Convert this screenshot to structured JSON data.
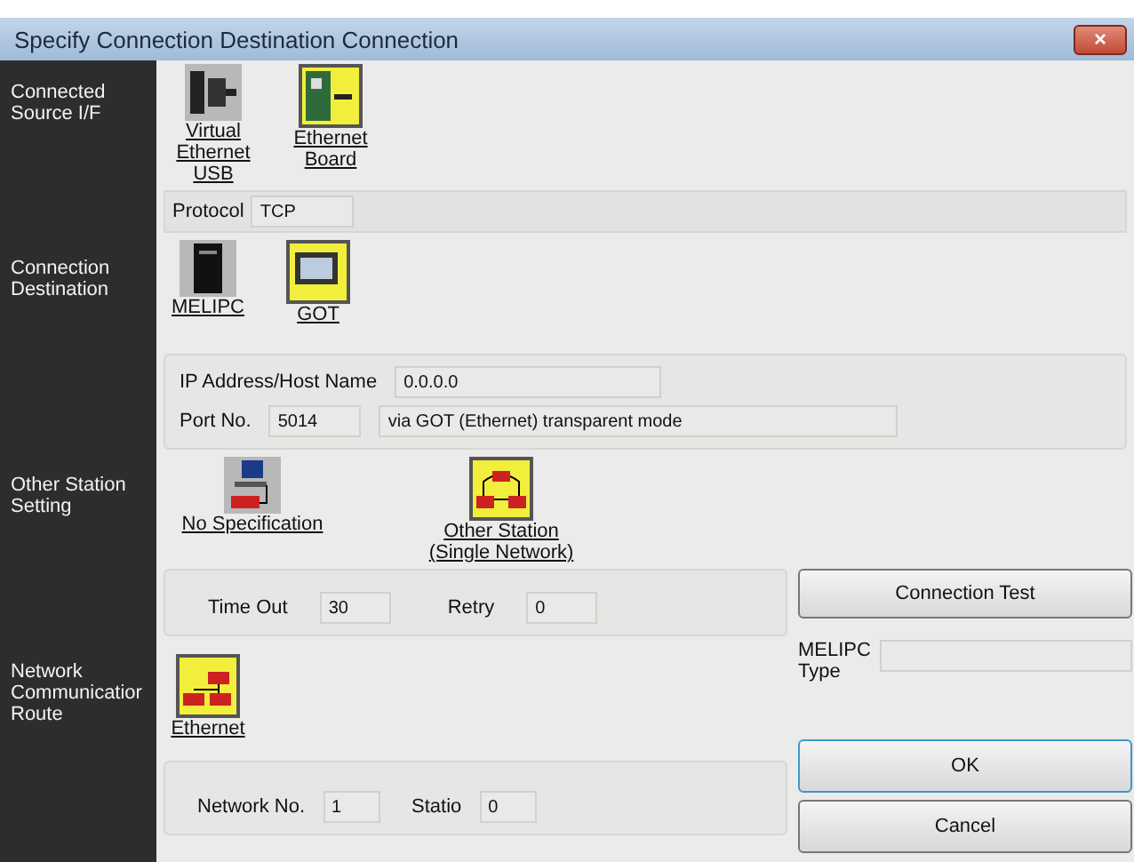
{
  "window": {
    "title": "Specify Connection Destination Connection",
    "close": "×"
  },
  "sections": [
    {
      "kind": "source",
      "label": "Connected Source I/F",
      "options": [
        {
          "kind": "usb",
          "label": "Virtual Ethernet USB",
          "selected": false
        },
        {
          "kind": "board",
          "label": "Ethernet Board",
          "selected": true
        }
      ],
      "protocol": {
        "label": "Protocol",
        "value": "TCP"
      }
    },
    {
      "kind": "destination",
      "label": "Connection Destination",
      "options": [
        {
          "kind": "server",
          "label": "MELIPC",
          "selected": false
        },
        {
          "kind": "panel",
          "label": "GOT",
          "selected": true
        }
      ],
      "ip": {
        "label": "IP Address/Host Name",
        "value": "0.0.0.0"
      },
      "port": {
        "label": "Port No.",
        "value": "5014",
        "note": "via GOT (Ethernet) transparent mode"
      }
    },
    {
      "kind": "station",
      "label": "Other Station Setting",
      "options": [
        {
          "kind": "pc",
          "label": "No Specification",
          "selected": false
        },
        {
          "kind": "network",
          "label": "Other Station (Single Network)",
          "selected": true
        }
      ],
      "timeout": {
        "label": "Time Out",
        "value": "30"
      },
      "retry": {
        "label": "Retry",
        "value": "0"
      },
      "test_button": "Connection Test"
    },
    {
      "kind": "route",
      "label": "Network Communicatior Route",
      "options": [
        {
          "kind": "ethernet",
          "label": "Ethernet",
          "selected": true
        }
      ],
      "network": {
        "label": "Network No.",
        "value": "1"
      },
      "station": {
        "label": "Statio",
        "value": "0"
      },
      "melipc_type": {
        "label": "MELIPC Type"
      },
      "buttons": [
        "OK",
        "Cancel"
      ]
    }
  ]
}
